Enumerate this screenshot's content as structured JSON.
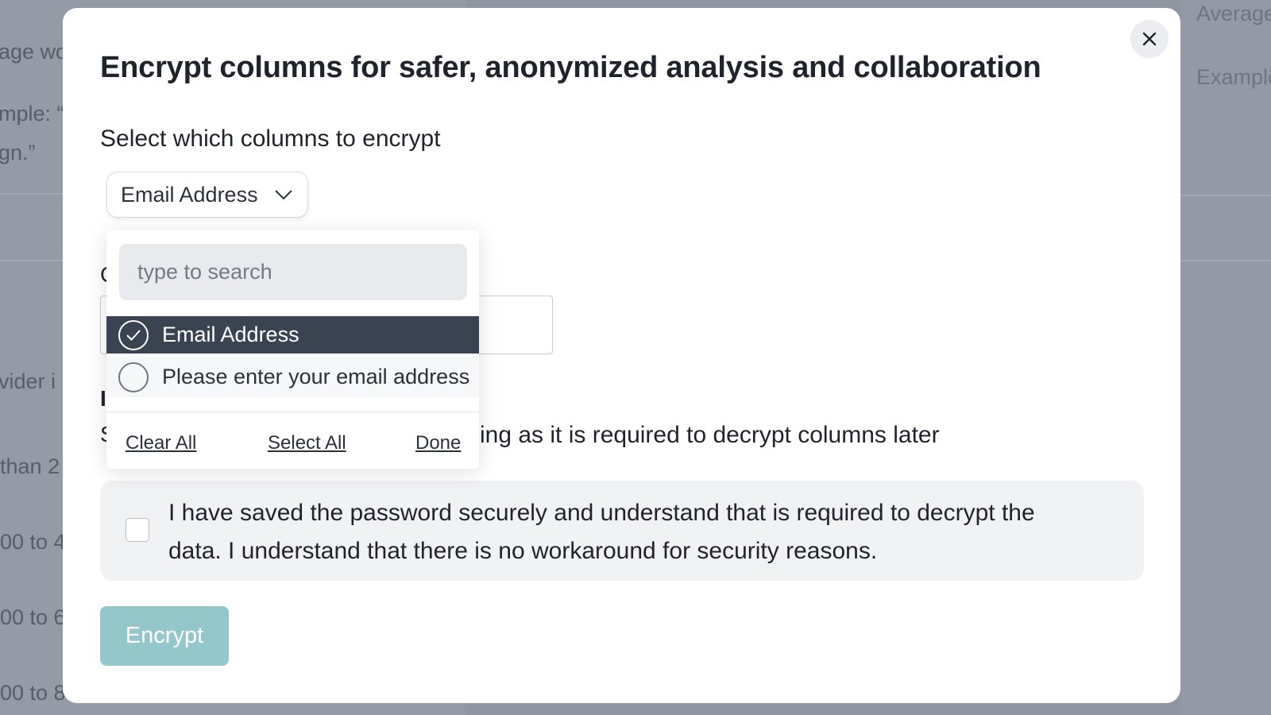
{
  "background": {
    "left_fragments": [
      "age wo",
      "mple: “I",
      "gn.”",
      "vider i",
      "than 2",
      "00 to 4",
      "00 to 6",
      "00 to 8"
    ],
    "right_fragments": [
      "Average",
      "Example"
    ]
  },
  "modal": {
    "title": "Encrypt columns for safer, anonymized analysis and collaboration",
    "close_icon": "close-icon",
    "select_label": "Select which columns to encrypt",
    "selected_column": "Email Address",
    "partially_hidden": {
      "password_label_first_char": "C",
      "section_heading_first_char": "I",
      "hint_first_char": "S",
      "hint_visible_text": "ing as it is required to decrypt columns later"
    },
    "acknowledgement": {
      "checked": false,
      "text": "I have saved the password securely and understand that is required to decrypt the data. I understand that there is no workaround for security reasons."
    },
    "encrypt_button": "Encrypt"
  },
  "dropdown": {
    "search_placeholder": "type to search",
    "options": [
      {
        "label": "Email Address",
        "selected": true
      },
      {
        "label": "Please enter your email address",
        "selected": false
      }
    ],
    "clear_all": "Clear All",
    "select_all": "Select All",
    "done": "Done"
  },
  "colors": {
    "overlay": "#8f96a1",
    "selected_option_bg": "#3a4352",
    "encrypt_button_bg": "#93c7cc",
    "ack_box_bg": "#f1f2f4"
  }
}
